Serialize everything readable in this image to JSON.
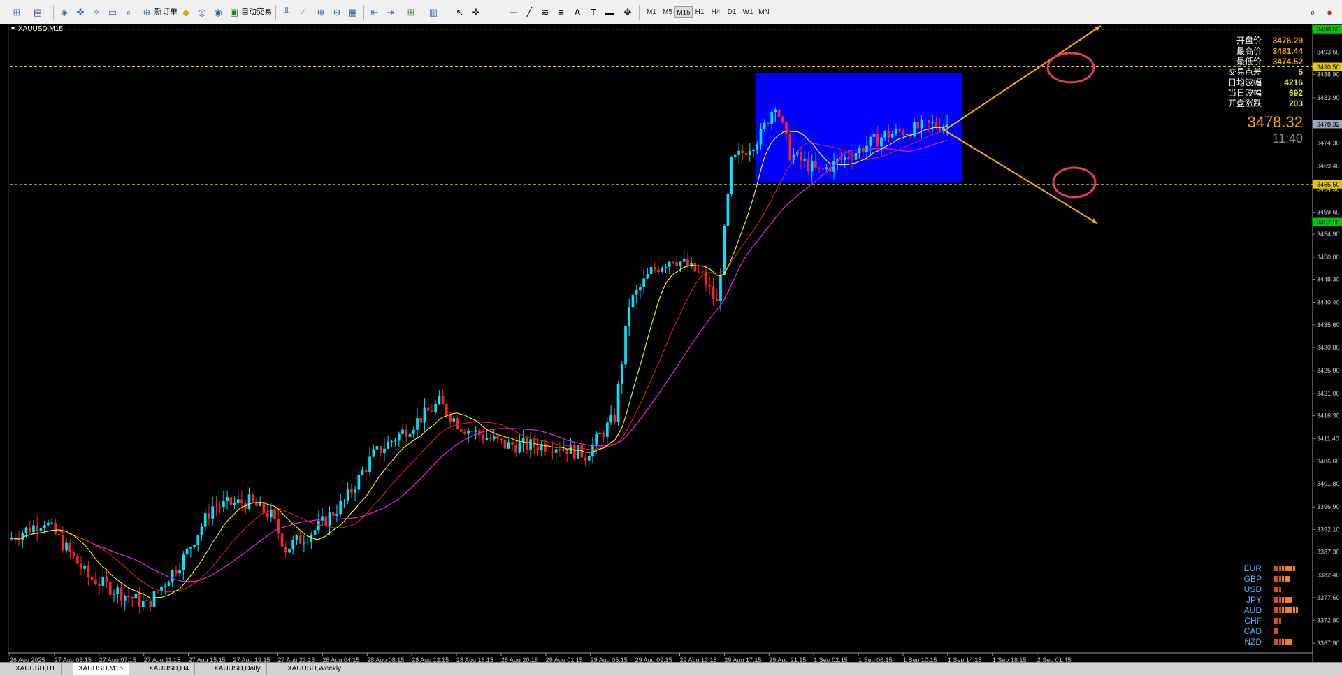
{
  "toolbar": {
    "new_order_label": "新订单",
    "auto_trade_label": "自动交易",
    "timeframes": [
      "M1",
      "M5",
      "M15",
      "H1",
      "H4",
      "D1",
      "W1",
      "MN"
    ],
    "active_timeframe": "M15"
  },
  "chart": {
    "symbol_label": "XAUUSD,M15",
    "last_price": "3478.32",
    "countdown": "11:40",
    "info_panel": [
      {
        "label": "开盘价",
        "value": "3476.29"
      },
      {
        "label": "最高价",
        "value": "3481.44"
      },
      {
        "label": "最低价",
        "value": "3474.52"
      },
      {
        "label": "交易点差",
        "value": "5"
      },
      {
        "label": "日均波幅",
        "value": "4216"
      },
      {
        "label": "当日波幅",
        "value": "692"
      },
      {
        "label": "开盘涨跌",
        "value": "203"
      }
    ],
    "currency_strength": [
      {
        "currency": "EUR"
      },
      {
        "currency": "GBP"
      },
      {
        "currency": "USD"
      },
      {
        "currency": "JPY"
      },
      {
        "currency": "AUD"
      },
      {
        "currency": "CHF"
      },
      {
        "currency": "CAD"
      },
      {
        "currency": "NZD"
      }
    ],
    "price_labels": [
      "3498.50",
      "3490.50",
      "3478.32",
      "3465.50",
      "3457.50"
    ],
    "colors": {
      "background": "#000000",
      "bull": "#00e5ff",
      "bear": "#ff2020",
      "ma_fast": "#ffff00",
      "ma_mid": "#e02020",
      "ma_slow": "#e020e0",
      "box": "#0000ff",
      "arrow": "#ffb000",
      "circle": "#e04050"
    }
  },
  "chart_data": {
    "type": "candlestick",
    "y_axis_ticks": [
      "3493.60",
      "3488.90",
      "3483.90",
      "3474.30",
      "3469.40",
      "3464.50",
      "3459.60",
      "3454.90",
      "3450.00",
      "3445.30",
      "3440.40",
      "3435.60",
      "3430.80",
      "3425.90",
      "3421.00",
      "3416.30",
      "3411.40",
      "3406.60",
      "3401.80",
      "3396.90",
      "3392.10",
      "3387.30",
      "3382.40",
      "3377.60",
      "3372.80",
      "3367.90"
    ],
    "x_axis_ticks": [
      "26 Aug 2025",
      "27 Aug 03:15",
      "27 Aug 07:15",
      "27 Aug 11:15",
      "27 Aug 15:15",
      "27 Aug 19:15",
      "27 Aug 23:15",
      "28 Aug 04:15",
      "28 Aug 08:15",
      "28 Aug 12:15",
      "28 Aug 16:15",
      "28 Aug 20:15",
      "29 Aug 01:15",
      "29 Aug 05:15",
      "29 Aug 09:15",
      "29 Aug 13:15",
      "29 Aug 17:15",
      "29 Aug 21:15",
      "1 Sep 02:15",
      "1 Sep 06:15",
      "1 Sep 10:15",
      "1 Sep 14:15",
      "1 Sep 18:15",
      "2 Sep 01:45"
    ],
    "horizontal_levels": [
      3498.5,
      3490.5,
      3478.32,
      3465.5,
      3457.5
    ]
  },
  "tabs": [
    "XAUUSD,H1",
    "XAUUSD,M15",
    "XAUUSD,H4",
    "XAUUSD,Daily",
    "XAUUSD,Weekly"
  ]
}
